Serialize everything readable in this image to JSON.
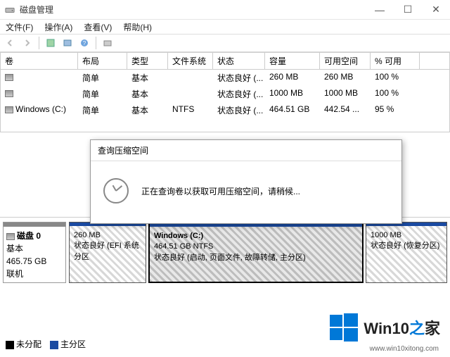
{
  "window": {
    "title": "磁盘管理",
    "minimize": "—",
    "maximize": "☐",
    "close": "✕"
  },
  "menu": {
    "file": "文件(F)",
    "action": "操作(A)",
    "view": "查看(V)",
    "help": "帮助(H)"
  },
  "columns": {
    "volume": "卷",
    "layout": "布局",
    "type": "类型",
    "fs": "文件系统",
    "status": "状态",
    "capacity": "容量",
    "free": "可用空间",
    "pct": "% 可用"
  },
  "rows": [
    {
      "vol": "",
      "layout": "简单",
      "type": "基本",
      "fs": "",
      "status": "状态良好 (...",
      "cap": "260 MB",
      "free": "260 MB",
      "pct": "100 %"
    },
    {
      "vol": "",
      "layout": "简单",
      "type": "基本",
      "fs": "",
      "status": "状态良好 (...",
      "cap": "1000 MB",
      "free": "1000 MB",
      "pct": "100 %"
    },
    {
      "vol": "Windows (C:)",
      "layout": "简单",
      "type": "基本",
      "fs": "NTFS",
      "status": "状态良好 (...",
      "cap": "464.51 GB",
      "free": "442.54 ...",
      "pct": "95 %"
    }
  ],
  "disk": {
    "label": "磁盘 0",
    "type": "基本",
    "size": "465.75 GB",
    "online": "联机"
  },
  "parts": [
    {
      "line1": "260 MB",
      "line2": "状态良好 (EFI 系统分区"
    },
    {
      "line1": "Windows  (C:)",
      "line2": "464.51 GB NTFS",
      "line3": "状态良好 (启动, 页面文件, 故障转储, 主分区)"
    },
    {
      "line1": "1000 MB",
      "line2": "状态良好 (恢复分区)"
    }
  ],
  "legend": {
    "unalloc": "未分配",
    "primary": "主分区"
  },
  "modal": {
    "title": "查询压缩空间",
    "message": "正在查询卷以获取可用压缩空间，请稍候..."
  },
  "watermark": {
    "brand1": "Win10",
    "brand2": "之",
    "brand3": "家",
    "sub": "www.win10xitong.com"
  }
}
